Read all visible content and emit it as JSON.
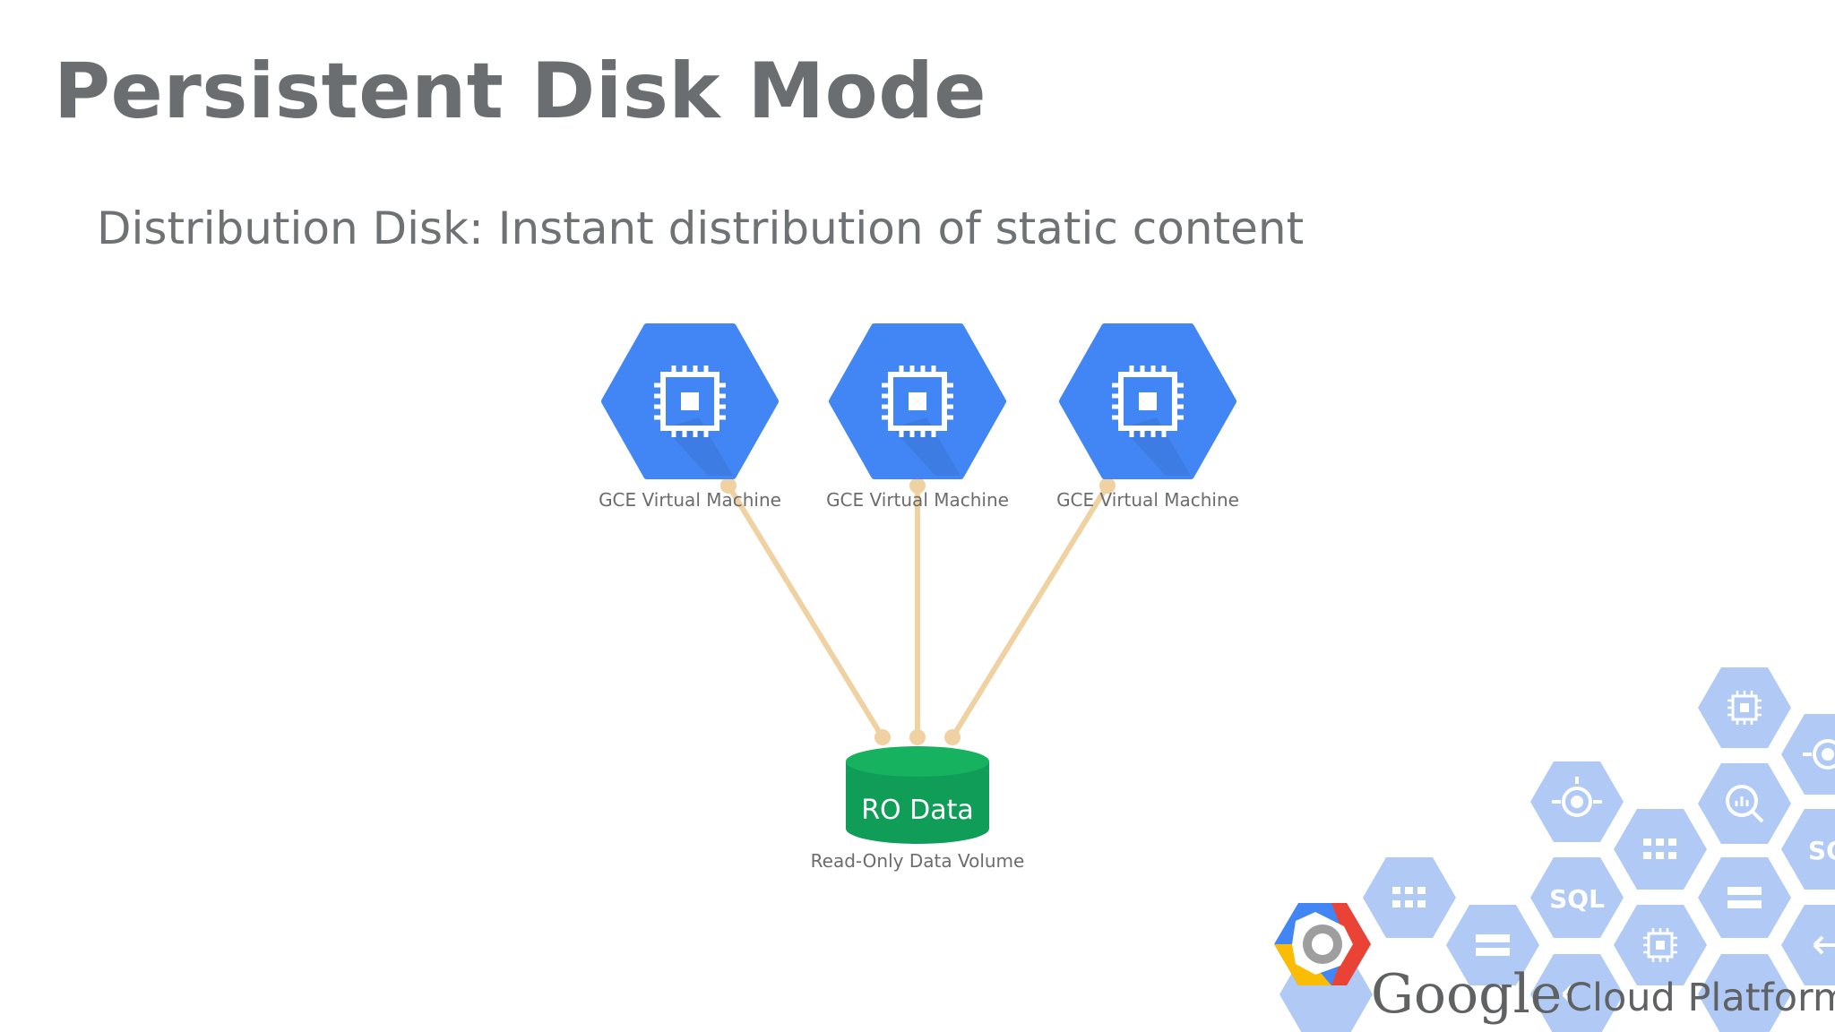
{
  "slide": {
    "title": "Persistent Disk Mode",
    "subtitle": "Distribution Disk: Instant distribution of static content"
  },
  "diagram": {
    "vms": [
      {
        "label": "GCE Virtual Machine",
        "icon": "cpu-chip-icon"
      },
      {
        "label": "GCE Virtual Machine",
        "icon": "cpu-chip-icon"
      },
      {
        "label": "GCE Virtual Machine",
        "icon": "cpu-chip-icon"
      }
    ],
    "volume": {
      "name": "RO Data",
      "label": "Read-Only Data Volume"
    },
    "colors": {
      "vm_hex": "#4285f4",
      "vm_hex_shadow": "#3b74d6",
      "connector": "#f0d2a2",
      "volume": "#0f9d58",
      "volume_top": "#16b25f"
    }
  },
  "branding": {
    "logo_word": "Google",
    "logo_product": "Cloud Platform",
    "hex_glyph_sql": "SQL",
    "hex_glyph_sq": "SQ",
    "hex_color": "#a8c4f4"
  }
}
